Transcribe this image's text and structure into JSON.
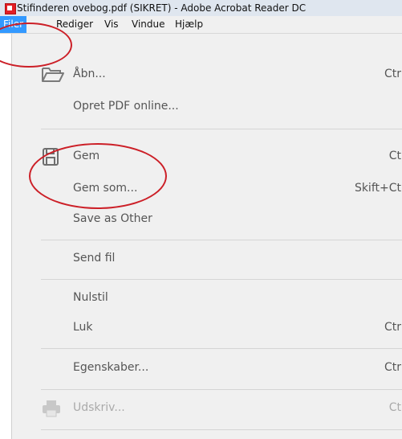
{
  "window": {
    "title": "Stifinderen ovebog.pdf (SIKRET) - Adobe Acrobat Reader DC"
  },
  "menubar": {
    "items": [
      {
        "label": "Filer"
      },
      {
        "label": "Rediger"
      },
      {
        "label": "Vis"
      },
      {
        "label": "Vindue"
      },
      {
        "label": "Hjælp"
      }
    ]
  },
  "file_menu": {
    "items": [
      {
        "label": "Åbn...",
        "shortcut": "Ctr"
      },
      {
        "label": "Opret PDF online...",
        "shortcut": ""
      },
      {
        "label": "Gem",
        "shortcut": "Ct"
      },
      {
        "label": "Gem som...",
        "shortcut": "Skift+Ct"
      },
      {
        "label": "Save as Other",
        "shortcut": ""
      },
      {
        "label": "Send fil",
        "shortcut": ""
      },
      {
        "label": "Nulstil",
        "shortcut": ""
      },
      {
        "label": "Luk",
        "shortcut": "Ctr"
      },
      {
        "label": "Egenskaber...",
        "shortcut": "Ctr"
      },
      {
        "label": "Udskriv...",
        "shortcut": "Ct"
      }
    ]
  },
  "colors": {
    "menu_highlight": "#3399ff",
    "annotation": "#cc1f27"
  }
}
